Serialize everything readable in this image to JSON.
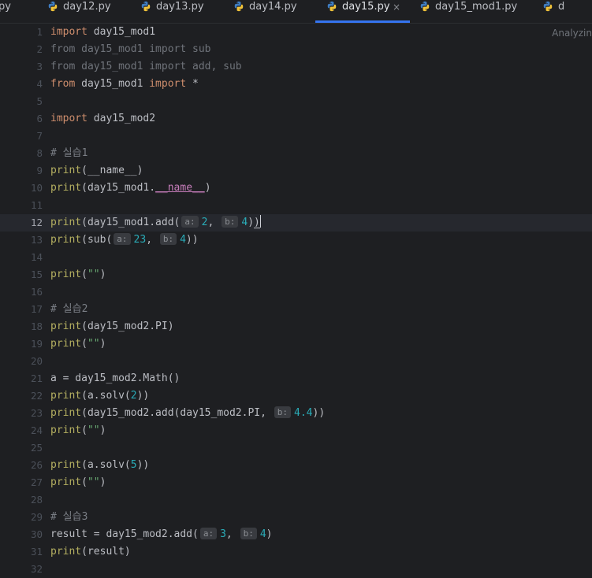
{
  "tabs": [
    {
      "label": "py",
      "icon": "python-file-icon",
      "active": false
    },
    {
      "label": "day12.py",
      "icon": "python-file-icon",
      "active": false
    },
    {
      "label": "day13.py",
      "icon": "python-file-icon",
      "active": false
    },
    {
      "label": "day14.py",
      "icon": "python-file-icon",
      "active": false
    },
    {
      "label": "day15.py",
      "icon": "python-file-icon",
      "active": true,
      "close": "×"
    },
    {
      "label": "day15_mod1.py",
      "icon": "python-file-icon",
      "active": false
    },
    {
      "label": "d",
      "icon": "python-file-icon",
      "active": false
    }
  ],
  "status_text": "Analyzin",
  "current_line": 12,
  "colors": {
    "background": "#1e1f22",
    "keyword": "#cf8e6d",
    "number": "#2aacb8",
    "string": "#6aab73",
    "comment": "#7a7e85",
    "builtin": "#b3ae60",
    "accent": "#3574f0"
  },
  "lines": [
    {
      "no": "1",
      "tokens": [
        [
          "import",
          "k"
        ],
        [
          " day15_mod1",
          ""
        ]
      ]
    },
    {
      "no": "2",
      "tokens": [
        [
          "from day15_mod1 import sub",
          "dim"
        ]
      ]
    },
    {
      "no": "3",
      "tokens": [
        [
          "from day15_mod1 import add, sub",
          "dim"
        ]
      ]
    },
    {
      "no": "4",
      "tokens": [
        [
          "from",
          "k"
        ],
        [
          " day15_mod1 ",
          ""
        ],
        [
          "import",
          "k"
        ],
        [
          " *",
          ""
        ]
      ]
    },
    {
      "no": "5",
      "tokens": []
    },
    {
      "no": "6",
      "tokens": [
        [
          "import",
          "k"
        ],
        [
          " day15_mod2",
          ""
        ]
      ]
    },
    {
      "no": "7",
      "tokens": []
    },
    {
      "no": "8",
      "tokens": [
        [
          "# 실습1",
          "c"
        ]
      ]
    },
    {
      "no": "9",
      "tokens": [
        [
          "print",
          "f"
        ],
        [
          "(__name__)",
          ""
        ]
      ]
    },
    {
      "no": "10",
      "tokens": [
        [
          "print",
          "f"
        ],
        [
          "(day15_mod1.",
          ""
        ],
        [
          "__name__",
          "m"
        ],
        [
          ")",
          ""
        ]
      ]
    },
    {
      "no": "11",
      "tokens": []
    },
    {
      "no": "12",
      "tokens": [
        [
          "print",
          "f"
        ],
        [
          "(day15_mod1.add(",
          ""
        ],
        [
          "a:",
          "hint"
        ],
        [
          "2",
          "n"
        ],
        [
          ", ",
          ""
        ],
        [
          "b:",
          "hint"
        ],
        [
          "4",
          "n"
        ],
        [
          ")",
          ""
        ],
        [
          ")",
          "bm"
        ],
        [
          "",
          "caret"
        ]
      ]
    },
    {
      "no": "13",
      "tokens": [
        [
          "print",
          "f"
        ],
        [
          "(sub(",
          ""
        ],
        [
          "a:",
          "hint"
        ],
        [
          "23",
          "n"
        ],
        [
          ", ",
          ""
        ],
        [
          "b:",
          "hint"
        ],
        [
          "4",
          "n"
        ],
        [
          "))",
          ""
        ]
      ]
    },
    {
      "no": "14",
      "tokens": []
    },
    {
      "no": "15",
      "tokens": [
        [
          "print",
          "f"
        ],
        [
          "(",
          ""
        ],
        [
          "\"\"",
          "s"
        ],
        [
          ")",
          ""
        ]
      ]
    },
    {
      "no": "16",
      "tokens": []
    },
    {
      "no": "17",
      "tokens": [
        [
          "# 실습2",
          "c"
        ]
      ]
    },
    {
      "no": "18",
      "tokens": [
        [
          "print",
          "f"
        ],
        [
          "(day15_mod2.PI)",
          ""
        ]
      ]
    },
    {
      "no": "19",
      "tokens": [
        [
          "print",
          "f"
        ],
        [
          "(",
          ""
        ],
        [
          "\"\"",
          "s"
        ],
        [
          ")",
          ""
        ]
      ]
    },
    {
      "no": "20",
      "tokens": []
    },
    {
      "no": "21",
      "tokens": [
        [
          "a = day15_mod2.Math()",
          ""
        ]
      ]
    },
    {
      "no": "22",
      "tokens": [
        [
          "print",
          "f"
        ],
        [
          "(a.solv(",
          ""
        ],
        [
          "2",
          "n"
        ],
        [
          "))",
          ""
        ]
      ]
    },
    {
      "no": "23",
      "tokens": [
        [
          "print",
          "f"
        ],
        [
          "(day15_mod2.add(day15_mod2.PI, ",
          ""
        ],
        [
          "b:",
          "hint"
        ],
        [
          "4.4",
          "n"
        ],
        [
          "))",
          ""
        ]
      ]
    },
    {
      "no": "24",
      "tokens": [
        [
          "print",
          "f"
        ],
        [
          "(",
          ""
        ],
        [
          "\"\"",
          "s"
        ],
        [
          ")",
          ""
        ]
      ]
    },
    {
      "no": "25",
      "tokens": []
    },
    {
      "no": "26",
      "tokens": [
        [
          "print",
          "f"
        ],
        [
          "(a.solv(",
          ""
        ],
        [
          "5",
          "n"
        ],
        [
          "))",
          ""
        ]
      ]
    },
    {
      "no": "27",
      "tokens": [
        [
          "print",
          "f"
        ],
        [
          "(",
          ""
        ],
        [
          "\"\"",
          "s"
        ],
        [
          ")",
          ""
        ]
      ]
    },
    {
      "no": "28",
      "tokens": []
    },
    {
      "no": "29",
      "tokens": [
        [
          "# 실습3",
          "c"
        ]
      ]
    },
    {
      "no": "30",
      "tokens": [
        [
          "result = day15_mod2.add(",
          ""
        ],
        [
          "a:",
          "hint"
        ],
        [
          "3",
          "n"
        ],
        [
          ", ",
          ""
        ],
        [
          "b:",
          "hint"
        ],
        [
          "4",
          "n"
        ],
        [
          ")",
          ""
        ]
      ]
    },
    {
      "no": "31",
      "tokens": [
        [
          "print",
          "f"
        ],
        [
          "(result)",
          ""
        ]
      ]
    },
    {
      "no": "32",
      "tokens": []
    }
  ]
}
